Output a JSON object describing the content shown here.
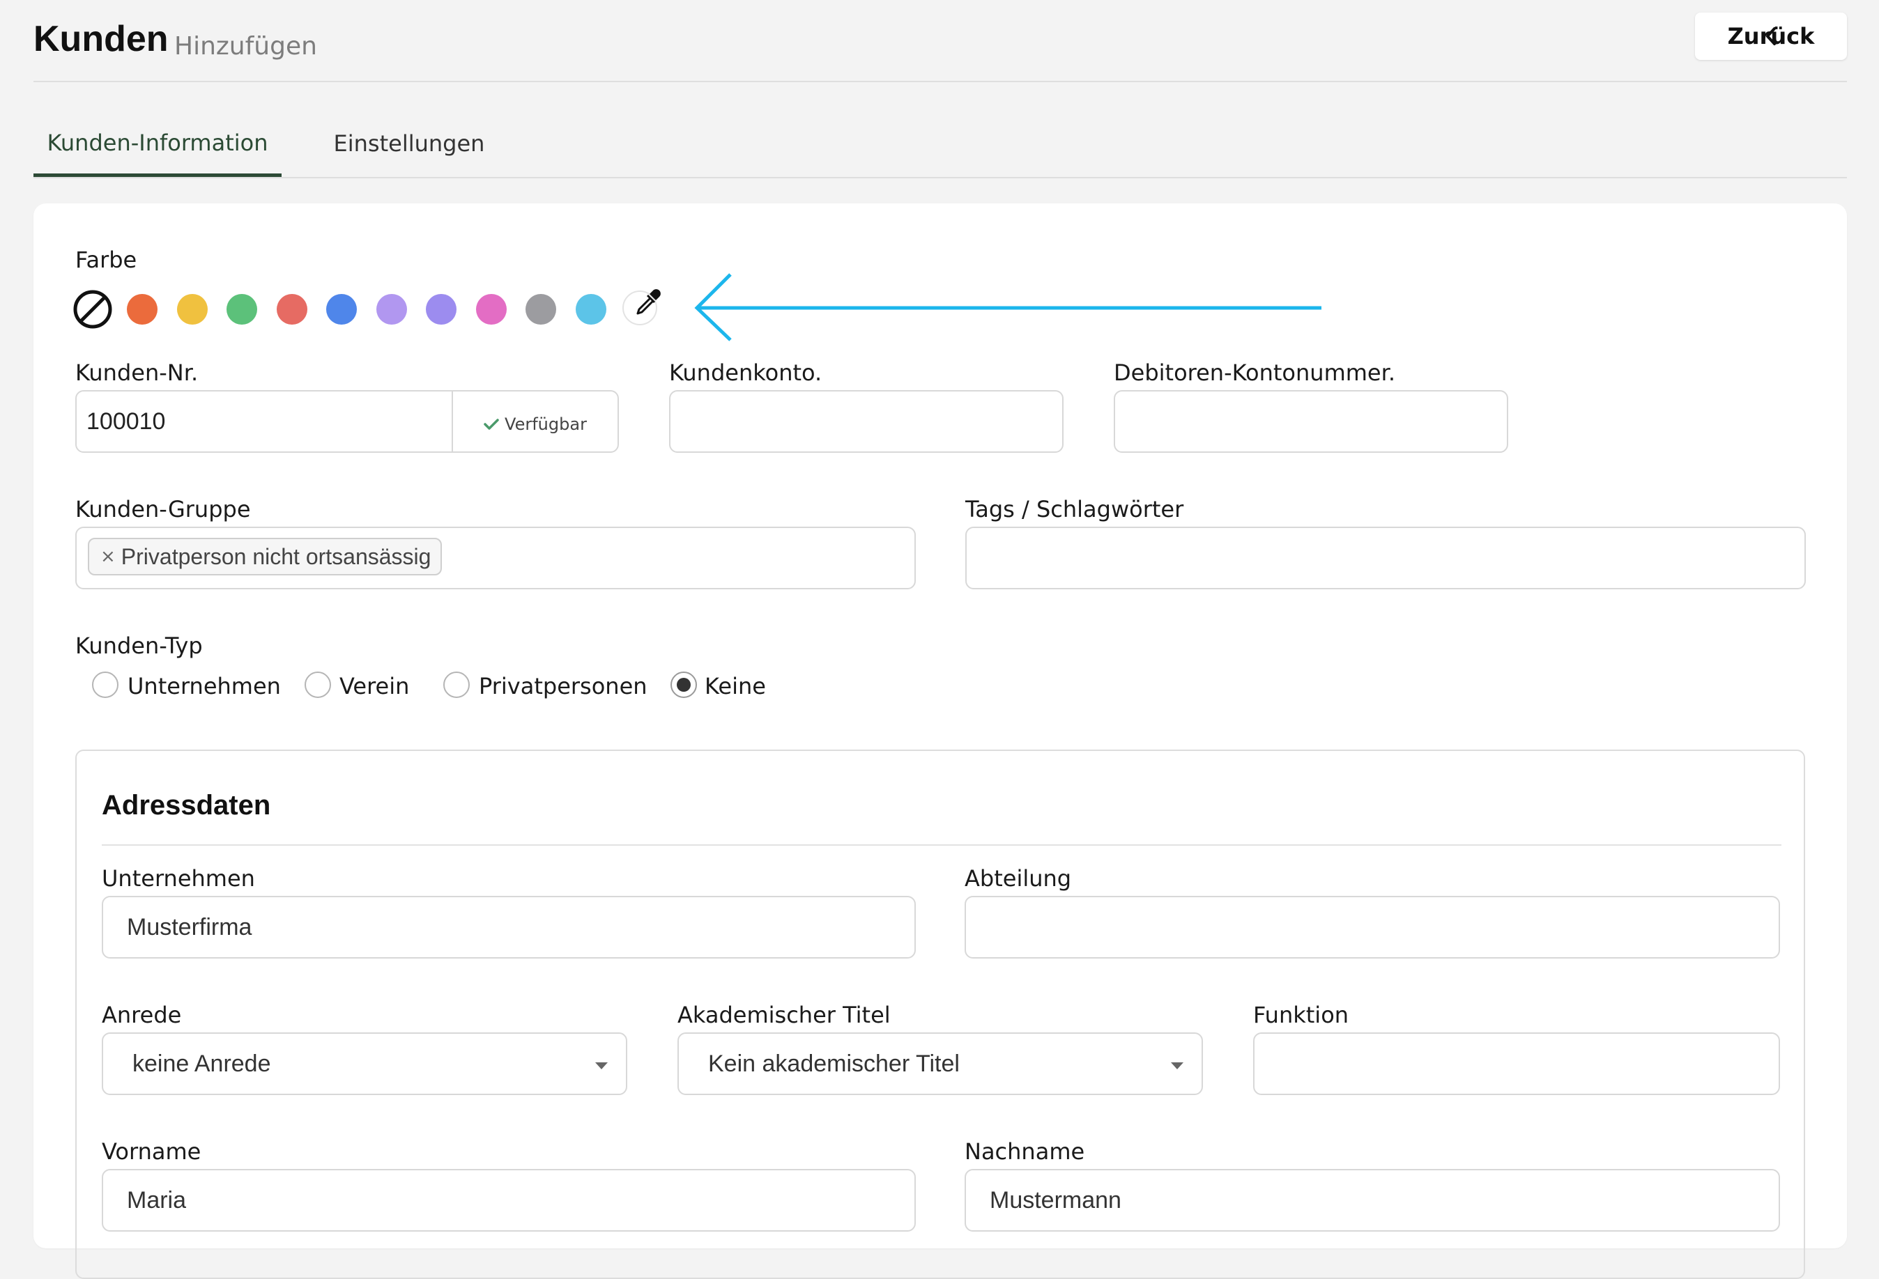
{
  "header": {
    "title": "Kunden",
    "subtitle": "Hinzufügen",
    "back_label": "Zurück"
  },
  "tabs": [
    {
      "label": "Kunden-Information",
      "active": true
    },
    {
      "label": "Einstellungen",
      "active": false
    }
  ],
  "color": {
    "label": "Farbe",
    "swatches": [
      "#eb6b3c",
      "#f0c13f",
      "#5cc17a",
      "#e66b63",
      "#4f86ea",
      "#b197f0",
      "#9c8cef",
      "#e36dc4",
      "#9c9ca0",
      "#5cc4e8"
    ],
    "arrow_color": "#1cb6ec"
  },
  "customer_number": {
    "label": "Kunden-Nr.",
    "value": "100010",
    "status": "Verfügbar"
  },
  "customer_account": {
    "label": "Kundenkonto.",
    "value": ""
  },
  "debtor_account": {
    "label": "Debitoren-Kontonummer.",
    "value": ""
  },
  "customer_group": {
    "label": "Kunden-Gruppe",
    "tag": "Privatperson nicht ortsansässig"
  },
  "tags": {
    "label": "Tags / Schlagwörter",
    "value": ""
  },
  "customer_type": {
    "label": "Kunden-Typ",
    "options": [
      {
        "label": "Unternehmen",
        "checked": false
      },
      {
        "label": "Verein",
        "checked": false
      },
      {
        "label": "Privatpersonen",
        "checked": false
      },
      {
        "label": "Keine",
        "checked": true
      }
    ]
  },
  "address": {
    "title": "Adressdaten",
    "company": {
      "label": "Unternehmen",
      "value": "Musterfirma"
    },
    "department": {
      "label": "Abteilung",
      "value": ""
    },
    "salutation": {
      "label": "Anrede",
      "value": "keine Anrede"
    },
    "academic_title": {
      "label": "Akademischer Titel",
      "value": "Kein akademischer Titel"
    },
    "function": {
      "label": "Funktion",
      "value": ""
    },
    "first_name": {
      "label": "Vorname",
      "value": "Maria"
    },
    "last_name": {
      "label": "Nachname",
      "value": "Mustermann"
    }
  }
}
